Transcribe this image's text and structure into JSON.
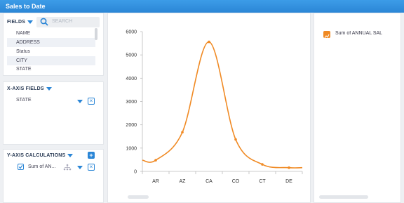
{
  "window": {
    "title": "Sales to Date"
  },
  "fields_panel": {
    "header": "FIELDS",
    "search_placeholder": "SEARCH",
    "items": [
      "NAME",
      "ADDRESS",
      "Status",
      "CITY",
      "STATE"
    ]
  },
  "xaxis_panel": {
    "header": "X-AXIS FIELDS",
    "field": "STATE"
  },
  "yaxis_panel": {
    "header": "Y-AXIS CALCULATIONS",
    "calc": "Sum of AN..."
  },
  "chart_data": {
    "type": "line",
    "categories": [
      "AR",
      "AZ",
      "CA",
      "CO",
      "CT",
      "DE"
    ],
    "series": [
      {
        "name": "Sum of ANNUAL SAL",
        "values": [
          480,
          1680,
          5560,
          1370,
          300,
          160
        ],
        "color": "#f08a24"
      }
    ],
    "ylim": [
      0,
      6000
    ],
    "yticks": [
      0,
      1000,
      2000,
      3000,
      4000,
      5000,
      6000
    ],
    "legend": "top-right"
  }
}
